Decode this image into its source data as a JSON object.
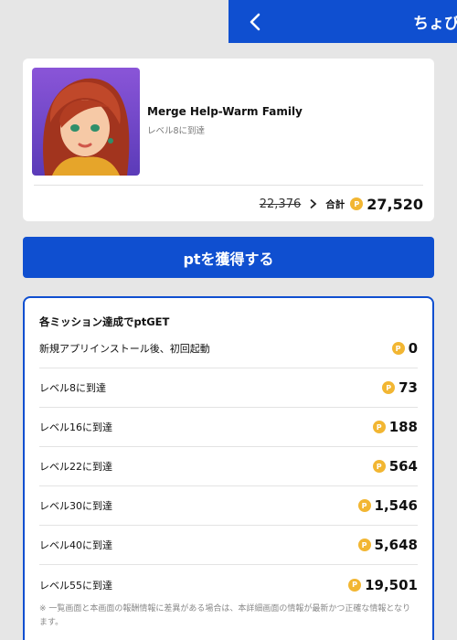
{
  "header": {
    "title": "ちょび"
  },
  "app": {
    "name": "Merge Help-Warm Family",
    "subtitle": "レベル8に到達",
    "old_points": "22,376",
    "total_label": "合計",
    "total_points": "27,520"
  },
  "coin_glyph": "P",
  "colors": {
    "brand": "#0f4fd0",
    "coin": "#f2b632",
    "background": "#e6e6e6"
  },
  "get_button": {
    "label": "ptを獲得する"
  },
  "missions": {
    "title": "各ミッション達成でptGET",
    "items": [
      {
        "label": "新規アプリインストール後、初回起動",
        "points": "0"
      },
      {
        "label": "レベル8に到達",
        "points": "73"
      },
      {
        "label": "レベル16に到達",
        "points": "188"
      },
      {
        "label": "レベル22に到達",
        "points": "564"
      },
      {
        "label": "レベル30に到達",
        "points": "1,546"
      },
      {
        "label": "レベル40に到達",
        "points": "5,648"
      },
      {
        "label": "レベル55に到達",
        "points": "19,501"
      }
    ],
    "footnote": "※ 一覧画面と本画面の報酬情報に差異がある場合は、本詳細画面の情報が最新かつ正確な情報となります。"
  }
}
